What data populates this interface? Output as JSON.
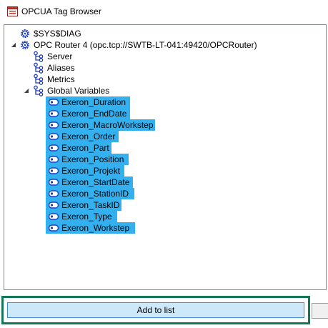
{
  "window": {
    "title": "OPCUA Tag Browser"
  },
  "tree": {
    "diag": {
      "label": "$SYS$DIAG"
    },
    "router": {
      "label": "OPC Router 4 (opc.tcp://SWTB-LT-041:49420/OPCRouter)",
      "children": [
        {
          "label": "Server"
        },
        {
          "label": "Aliases"
        },
        {
          "label": "Metrics"
        },
        {
          "label": "Global Variables"
        }
      ]
    },
    "variables": [
      {
        "label": "Exeron_Duration"
      },
      {
        "label": "Exeron_EndDate"
      },
      {
        "label": "Exeron_MacroWorkstep"
      },
      {
        "label": "Exeron_Order"
      },
      {
        "label": "Exeron_Part"
      },
      {
        "label": "Exeron_Position"
      },
      {
        "label": "Exeron_Projekt"
      },
      {
        "label": "Exeron_StartDate"
      },
      {
        "label": "Exeron_StationID"
      },
      {
        "label": "Exeron_TaskID"
      },
      {
        "label": "Exeron_Type"
      },
      {
        "label": "Exeron_Workstep"
      }
    ]
  },
  "actions": {
    "add_label": "Add to list"
  },
  "colors": {
    "selection": "#33b0ef",
    "highlight_frame": "#117a55",
    "button_bg": "#cde8f8",
    "icon_blue": "#1c3fbf"
  }
}
